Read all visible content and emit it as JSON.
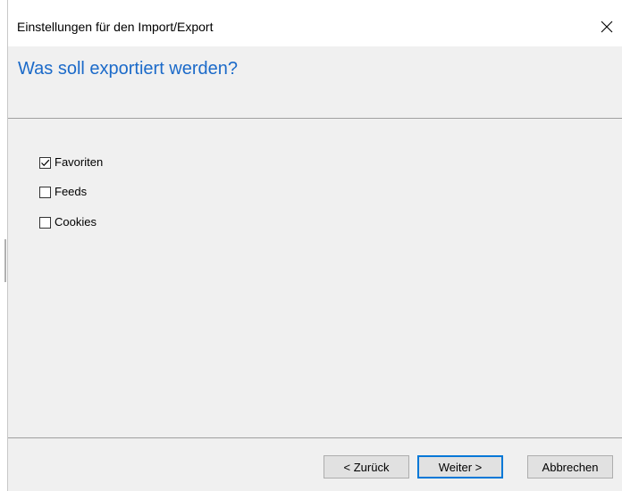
{
  "window": {
    "title": "Einstellungen für den Import/Export",
    "close_icon": "close-icon"
  },
  "header": {
    "title": "Was soll exportiert werden?"
  },
  "options": [
    {
      "label": "Favoriten",
      "checked": true
    },
    {
      "label": "Feeds",
      "checked": false
    },
    {
      "label": "Cookies",
      "checked": false
    }
  ],
  "buttons": {
    "back": "< Zurück",
    "next": "Weiter >",
    "cancel": "Abbrechen"
  },
  "colors": {
    "header_title": "#1b6ac9",
    "default_button_border": "#0078d7"
  }
}
